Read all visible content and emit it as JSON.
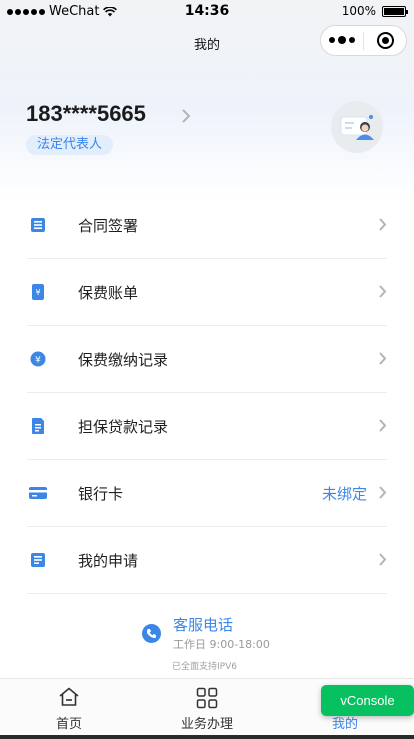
{
  "status_bar": {
    "carrier": "WeChat",
    "time": "14:36",
    "battery_percent": "100%",
    "battery_level": 1.0
  },
  "nav": {
    "title": "我的"
  },
  "profile": {
    "phone": "183****5665",
    "role": "法定代表人"
  },
  "menu": {
    "items": [
      {
        "label": "合同签署",
        "value": ""
      },
      {
        "label": "保费账单",
        "value": ""
      },
      {
        "label": "保费缴纳记录",
        "value": ""
      },
      {
        "label": "担保贷款记录",
        "value": ""
      },
      {
        "label": "银行卡",
        "value": "未绑定"
      },
      {
        "label": "我的申请",
        "value": ""
      }
    ]
  },
  "service": {
    "title": "客服电话",
    "hours": "工作日 9:00-18:00",
    "ipv6_note": "已全面支持IPV6"
  },
  "tabbar": {
    "items": [
      {
        "label": "首页"
      },
      {
        "label": "业务办理"
      },
      {
        "label": "我的"
      }
    ]
  },
  "vconsole": {
    "label": "vConsole"
  },
  "colors": {
    "accent": "#3c86e6",
    "vconsole": "#07c160"
  }
}
